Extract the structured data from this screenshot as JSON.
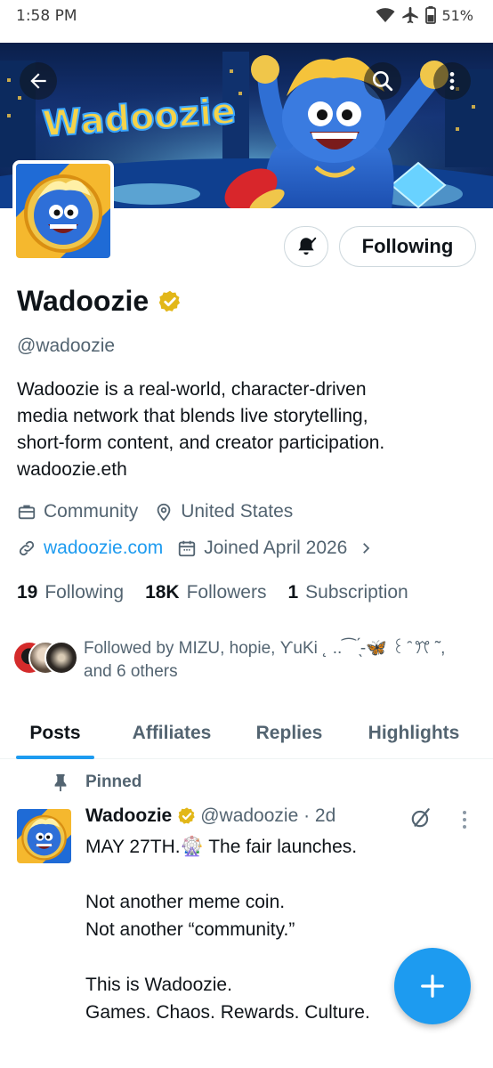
{
  "status_bar": {
    "time": "1:58 PM",
    "battery": "51%",
    "icons": [
      "wifi-icon",
      "airplane-icon",
      "battery-icon"
    ]
  },
  "banner": {
    "wordmark": "Wadoozie",
    "buttons": [
      "back-arrow-icon",
      "search-icon",
      "more-vertical-icon"
    ]
  },
  "profile": {
    "display_name": "Wadoozie",
    "verified": true,
    "handle": "@wadoozie",
    "bio_lines": [
      "Wadoozie is a real-world, character-driven",
      "media network that blends live storytelling,",
      "short-form content, and creator participation.",
      "wadoozie.eth"
    ],
    "category": "Community",
    "location": "United States",
    "website": "wadoozie.com",
    "joined": "Joined April 2026",
    "following_count": "19",
    "following_label": "Following",
    "followers_count": "18K",
    "followers_label": "Followers",
    "subscription_count": "1",
    "subscription_label": "Subscription",
    "followed_by_line1": "Followed by MIZU, hopie, ƳuKi ˛  ..⁀  ̖́-🦋 ꒰ ̑ ꔫ ˜,",
    "followed_by_line2": "and 6 others"
  },
  "actions": {
    "following_button": "Following",
    "bell_icon": "bell-subscribed-icon"
  },
  "tabs": [
    "Posts",
    "Affiliates",
    "Replies",
    "Highlights"
  ],
  "active_tab": "Posts",
  "pinned_post": {
    "pinned_label": "Pinned",
    "author_name": "Wadoozie",
    "author_handle": "@wadoozie · 2d",
    "lines": [
      "MAY 27TH.🎡 The fair launches.",
      "",
      "Not another meme coin.",
      "Not another “community.”",
      "",
      "This is Wadoozie.",
      "Games. Chaos. Rewards. Culture."
    ]
  },
  "colors": {
    "accent": "#1d9bf0",
    "verified_gold": "#e2b719",
    "secondary_text": "#536471",
    "primary_text": "#0f1419"
  }
}
